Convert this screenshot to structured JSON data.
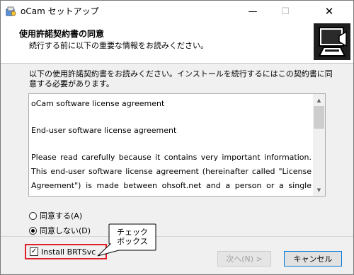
{
  "window": {
    "title": "oCam セットアップ",
    "controls": {
      "minimize": "—",
      "maximize": "☐",
      "close": "✕"
    }
  },
  "header": {
    "title": "使用許諾契約書の同意",
    "subtitle": "続行する前に以下の重要な情報をお読みください。",
    "icon": "installer-computer-icon"
  },
  "main": {
    "intro": "以下の使用許諾契約書をお読みください。インストールを続行するにはこの契約書に同意する必要があります。",
    "license_lines": [
      "oCam software license agreement",
      "End-user software license agreement",
      "Please read carefully because it contains very important information. This end-user software license agreement (hereinafter called \"License Agreement\") is made between ohsoft.net and a person or a single business (hereinafter called \"User\") for the software products which are developed"
    ],
    "radio_agree": "同意する(A)",
    "radio_disagree": "同意しない(D)",
    "selected": "disagree"
  },
  "footer": {
    "checkbox_label": "Install BRTSvc",
    "checkbox_checked": true,
    "next_label": "次へ(N) >",
    "cancel_label": "キャンセル"
  },
  "annotation": {
    "text_line1": "チェック",
    "text_line2": "ボックス"
  },
  "colors": {
    "highlight_border": "#e0202a",
    "default_button_border": "#0078d7"
  }
}
